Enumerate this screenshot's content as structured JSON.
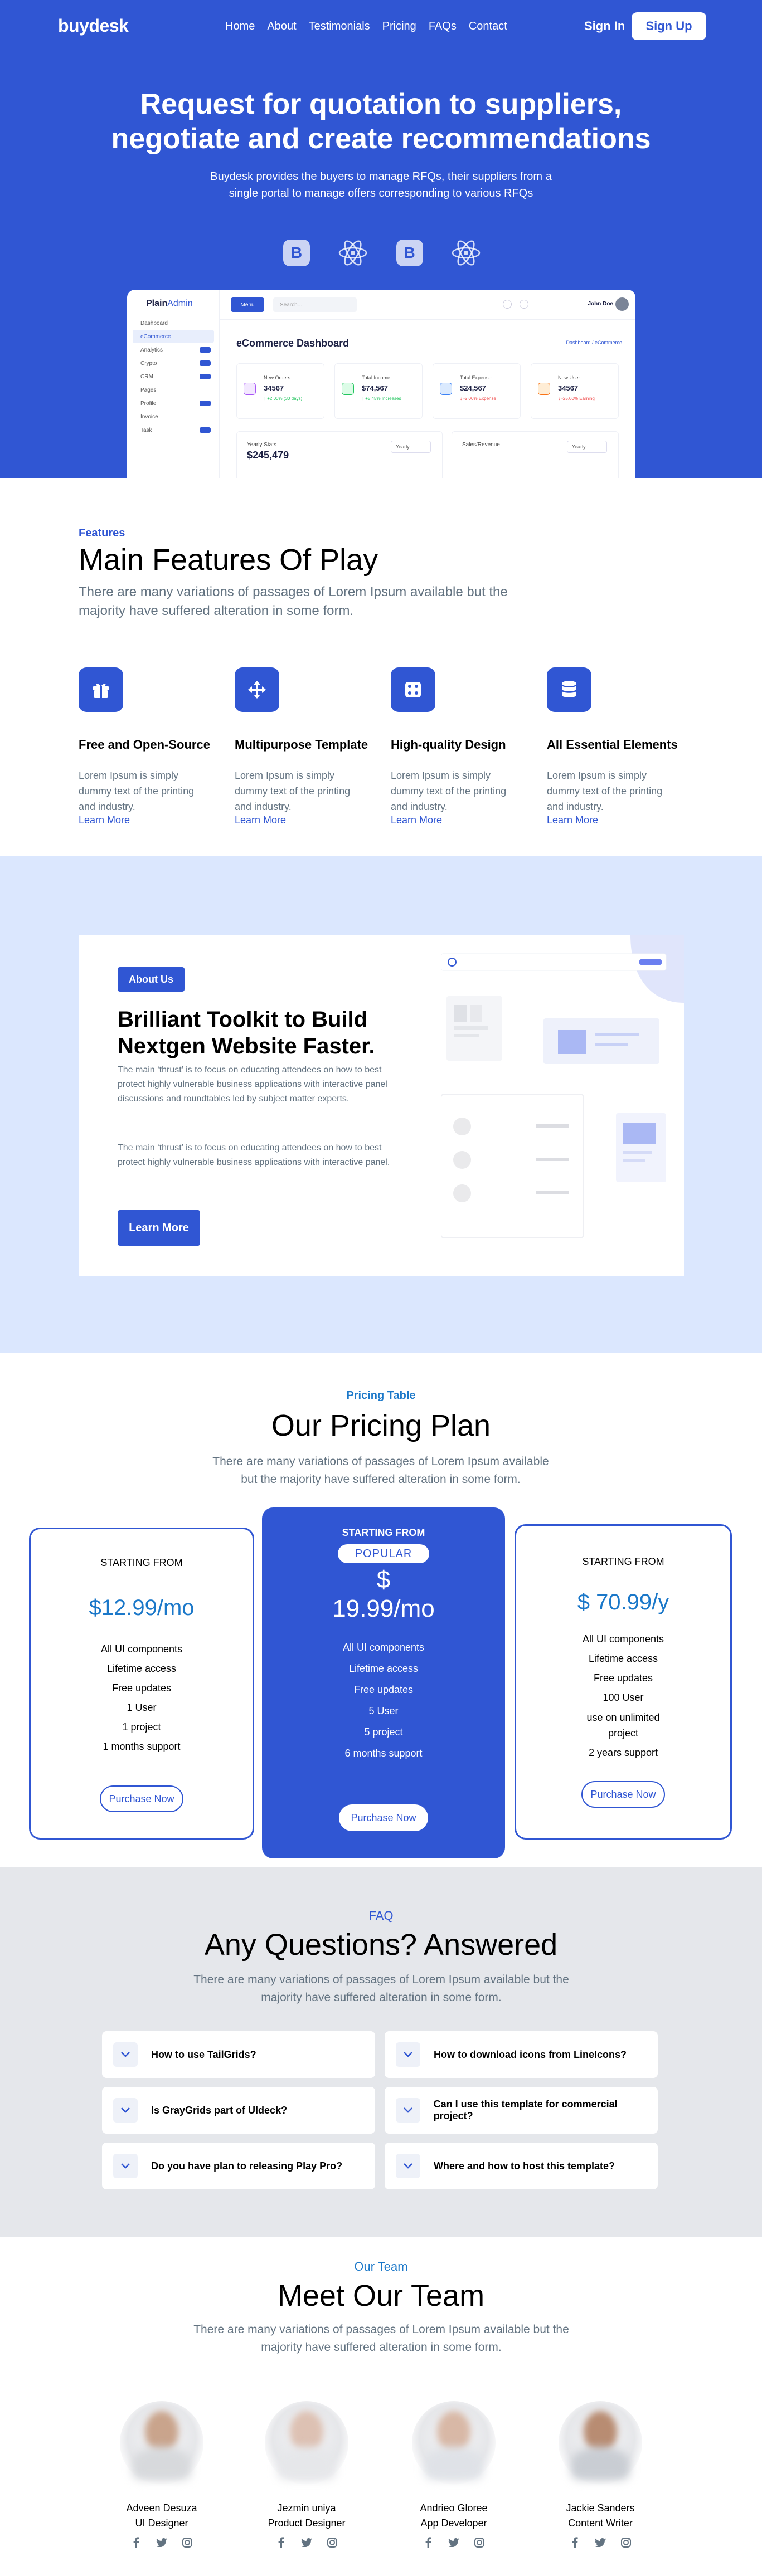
{
  "nav": {
    "logo": "buydesk",
    "menu": [
      "Home",
      "About",
      "Testimonials",
      "Pricing",
      "FAQs",
      "Contact"
    ],
    "sign_in": "Sign In",
    "sign_up": "Sign Up"
  },
  "hero": {
    "title": "Request for quotation to suppliers, negotiate and create recommendations",
    "subtitle": "Buydesk provides the buyers to manage RFQs, their suppliers from a single portal to manage offers corresponding to various RFQs",
    "tech_icons": [
      "bootstrap-icon",
      "react-icon",
      "bootstrap-icon",
      "react-icon"
    ],
    "bootstrap_letter": "B"
  },
  "dashboard": {
    "brand_prefix": "Plain",
    "brand_suffix": "Admin",
    "nav": [
      "Dashboard",
      "eCommerce",
      "Analytics",
      "Crypto",
      "CRM",
      "Pages",
      "Profile",
      "Invoice",
      "Task"
    ],
    "menu_button": "Menu",
    "search_placeholder": "Search...",
    "user_name": "John Doe",
    "title": "eCommerce Dashboard",
    "crumb": "Dashboard / eCommerce",
    "cards": [
      {
        "label": "New Orders",
        "value": "34567",
        "change": "↑ +2.00% (30 days)",
        "color": "#a855f7"
      },
      {
        "label": "Total Income",
        "value": "$74,567",
        "change": "↑ +5.45% Increased",
        "color": "#22c55e"
      },
      {
        "label": "Total Expense",
        "value": "$24,567",
        "change": "↓ -2.00% Expense",
        "color": "#3b82f6"
      },
      {
        "label": "New User",
        "value": "34567",
        "change": "↓ -25.00% Earning",
        "color": "#f97316"
      }
    ],
    "yearly_label": "Yearly Stats",
    "yearly_value": "$245,479",
    "yearly_select": "Yearly",
    "sales_label": "Sales/Revenue",
    "sales_select": "Yearly"
  },
  "features": {
    "kicker": "Features",
    "title": "Main Features Of Play",
    "description": "There are many variations of passages of Lorem Ipsum available but the majority have suffered alteration in some form.",
    "items": [
      {
        "icon": "gift-icon",
        "title": "Free and Open-Source",
        "text": "Lorem Ipsum is simply dummy text of the printing and industry.",
        "link": "Learn More"
      },
      {
        "icon": "move-arrows-icon",
        "title": "Multipurpose Template",
        "text": "Lorem Ipsum is simply dummy text of the printing and industry.",
        "link": "Learn More"
      },
      {
        "icon": "dice-icon",
        "title": "High-quality Design",
        "text": "Lorem Ipsum is simply dummy text of the printing and industry.",
        "link": "Learn More"
      },
      {
        "icon": "database-icon",
        "title": "All Essential Elements",
        "text": "Lorem Ipsum is simply dummy text of the printing and industry.",
        "link": "Learn More"
      }
    ]
  },
  "about": {
    "badge": "About Us",
    "title": "Brilliant Toolkit to Build Nextgen Website Faster.",
    "paragraph_1": "The main ‘thrust’ is to focus on educating attendees on how to best protect highly vulnerable business applications with interactive panel discussions and roundtables led by subject matter experts.",
    "paragraph_2": "The main ‘thrust’ is to focus on educating attendees on how to best protect highly vulnerable business applications with interactive panel.",
    "button": "Learn More"
  },
  "pricing": {
    "kicker": "Pricing Table",
    "title": "Our Pricing Plan",
    "description": "There are many variations of passages of Lorem Ipsum available but the majority have suffered alteration in some form.",
    "plans": [
      {
        "starting": "STARTING FROM",
        "price": "$12.99/mo",
        "features": [
          "All UI components",
          "Lifetime access",
          "Free updates",
          "1 User",
          "1 project",
          "1 months support"
        ],
        "button": "Purchase Now"
      },
      {
        "starting": "STARTING FROM",
        "badge": "POPULAR",
        "price_symbol": "$",
        "price": "19.99/mo",
        "features": [
          "All UI components",
          "Lifetime access",
          "Free updates",
          "5 User",
          "5 project",
          "6 months support"
        ],
        "button": "Purchase Now"
      },
      {
        "starting": "STARTING FROM",
        "price": "$ 70.99/y",
        "features": [
          "All UI components",
          "Lifetime access",
          "Free updates",
          "100 User",
          "use on unlimited project",
          "2 years support"
        ],
        "button": "Purchase Now"
      }
    ]
  },
  "faq": {
    "kicker": "FAQ",
    "title": "Any Questions? Answered",
    "description": "There are many variations of passages of Lorem Ipsum available but the majority have suffered alteration in some form.",
    "questions": [
      "How to use TailGrids?",
      "How to download icons from LineIcons?",
      "Is GrayGrids part of UIdeck?",
      "Can I use this template for commercial project?",
      "Do you have plan to releasing Play Pro?",
      "Where and how to host this template?"
    ]
  },
  "team": {
    "kicker": "Our Team",
    "title": "Meet Our Team",
    "description": "There are many variations of passages of Lorem Ipsum available but the majority have suffered alteration in some form.",
    "members": [
      {
        "name": "Adveen Desuza",
        "role": "UI Designer"
      },
      {
        "name": "Jezmin uniya",
        "role": "Product Designer"
      },
      {
        "name": "Andrieo Gloree",
        "role": "App Developer"
      },
      {
        "name": "Jackie Sanders",
        "role": "Content Writer"
      }
    ],
    "social_icons": [
      "facebook-icon",
      "twitter-icon",
      "instagram-icon"
    ]
  },
  "colors": {
    "primary": "#3056d3",
    "about_bg": "#dbe7fe",
    "faq_bg": "#e5e7eb",
    "price_text": "#1b78c9",
    "muted_text": "#637381"
  }
}
